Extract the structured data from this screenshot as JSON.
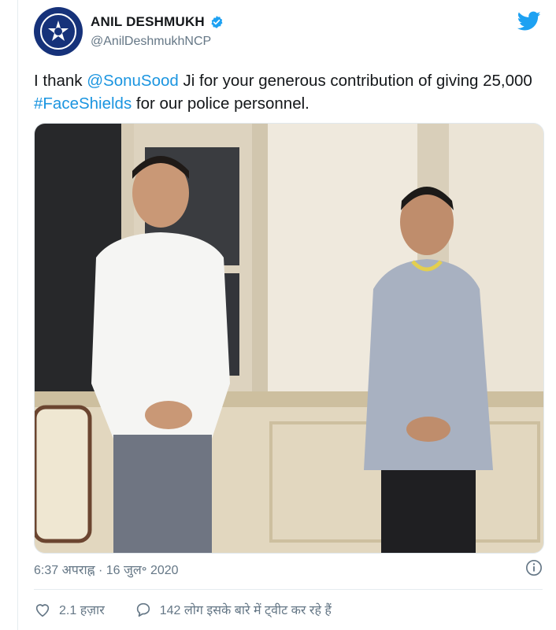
{
  "user": {
    "display_name": "ANIL DESHMUKH",
    "handle": "@AnilDeshmukhNCP",
    "verified": true,
    "avatar_icon": "police-emblem-icon"
  },
  "tweet": {
    "text_before": "I thank ",
    "mention": "@SonuSood",
    "text_middle": " Ji for your generous contribution of giving 25,000 ",
    "hashtag": "#FaceShields",
    "text_after": " for our police personnel."
  },
  "meta": {
    "timestamp": "6:37 अपराह्न · 16 जुल॰ 2020"
  },
  "actions": {
    "likes": "2.1 हज़ार",
    "replies": "142 लोग इसके बारे में ट्वीट कर रहे हैं"
  },
  "colors": {
    "link": "#1b95e0",
    "verified": "#1da1f2",
    "twitter_bird": "#1da1f2",
    "muted_text": "#657786"
  },
  "photo": {
    "description_icon": "photo-two-men-standing"
  }
}
